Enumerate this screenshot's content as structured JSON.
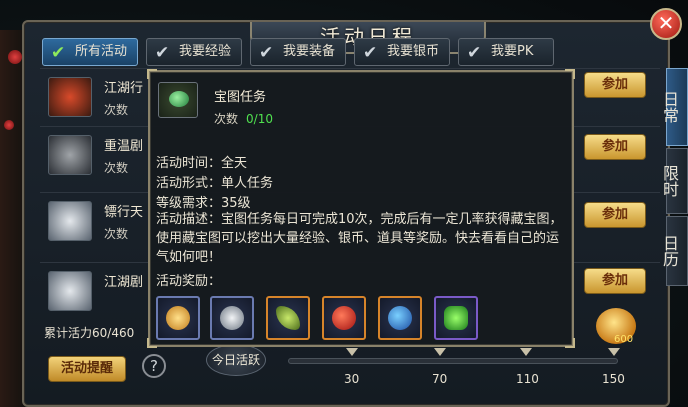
{
  "window": {
    "title": "活动日程",
    "close_symbol": "✕"
  },
  "tabs": [
    {
      "label": "所有活动",
      "active": true
    },
    {
      "label": "我要经验",
      "active": false
    },
    {
      "label": "我要装备",
      "active": false
    },
    {
      "label": "我要银币",
      "active": false
    },
    {
      "label": "我要PK",
      "active": false
    }
  ],
  "side_tabs": [
    {
      "label": "日常",
      "active": true
    },
    {
      "label": "限时",
      "active": false
    },
    {
      "label": "日历",
      "active": false
    }
  ],
  "activities": [
    {
      "name": "江湖行",
      "count_label": "次数",
      "join_label": "参加"
    },
    {
      "name": "重温剧",
      "count_label": "次数",
      "join_label": "参加"
    },
    {
      "name": "镖行天",
      "count_label": "次数",
      "join_label": "参加"
    },
    {
      "name": "江湖剧",
      "count_label": "次数",
      "join_label": "参加"
    }
  ],
  "tooltip": {
    "name": "宝图任务",
    "count_label": "次数",
    "count_value": "0/10",
    "time": "活动时间：全天",
    "form": "活动形式：单人任务",
    "level": "等级需求：35级",
    "description": "活动描述：宝图任务每日可完成10次，完成后有一定几率获得藏宝图，使用藏宝图可以挖出大量经验、银币、道具等奖励。快去看看自己的运气如何吧！",
    "rewards_label": "活动奖励：",
    "rewards": [
      {
        "icon": "coin-stack-icon",
        "rarity": "blue"
      },
      {
        "icon": "silver-ingot-icon",
        "rarity": "blue"
      },
      {
        "icon": "jade-feather-icon",
        "rarity": "orange"
      },
      {
        "icon": "red-orb-icon",
        "rarity": "orange"
      },
      {
        "icon": "blue-orb-icon",
        "rarity": "orange"
      },
      {
        "icon": "green-crystal-icon",
        "rarity": "purple"
      }
    ]
  },
  "bottom": {
    "vitality_label": "累计活力60/460",
    "reminder_label": "活动提醒",
    "help_symbol": "?",
    "today_label": "今日活跃",
    "milestones": [
      "30",
      "70",
      "110",
      "150"
    ],
    "chest_value": "600"
  },
  "colors": {
    "accent": "#2e6a9e",
    "gold": "#f6dc8a",
    "highlight_green": "#4fe04f"
  }
}
